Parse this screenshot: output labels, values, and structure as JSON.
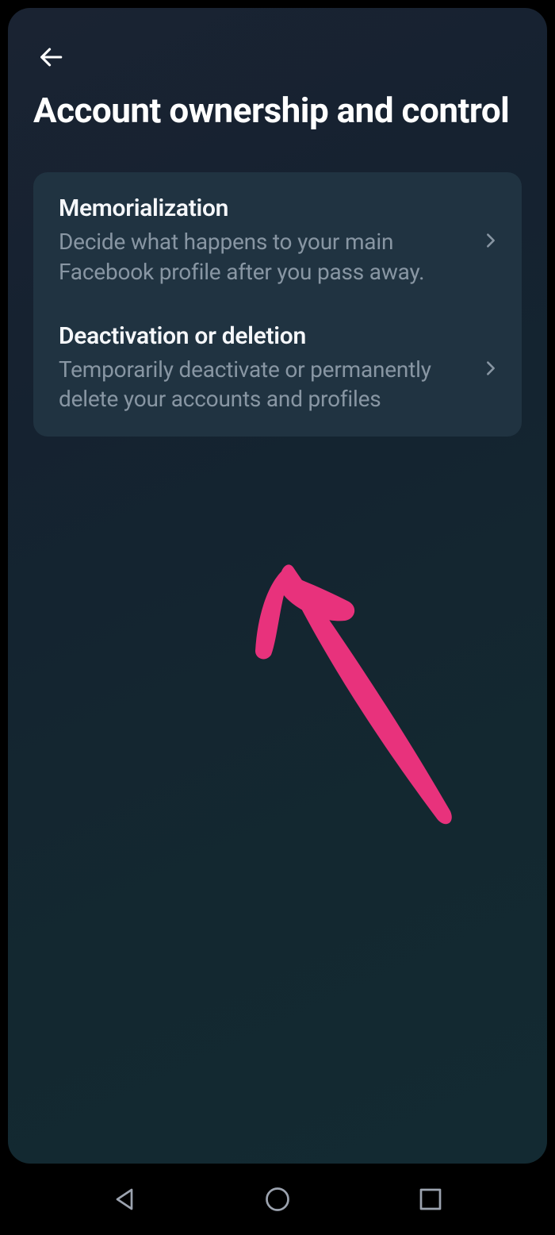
{
  "header": {
    "title": "Account ownership and control"
  },
  "options": [
    {
      "title": "Memorialization",
      "description": "Decide what happens to your main Facebook profile after you pass away."
    },
    {
      "title": "Deactivation or deletion",
      "description": "Temporarily deactivate or permanently delete your accounts and profiles"
    }
  ]
}
